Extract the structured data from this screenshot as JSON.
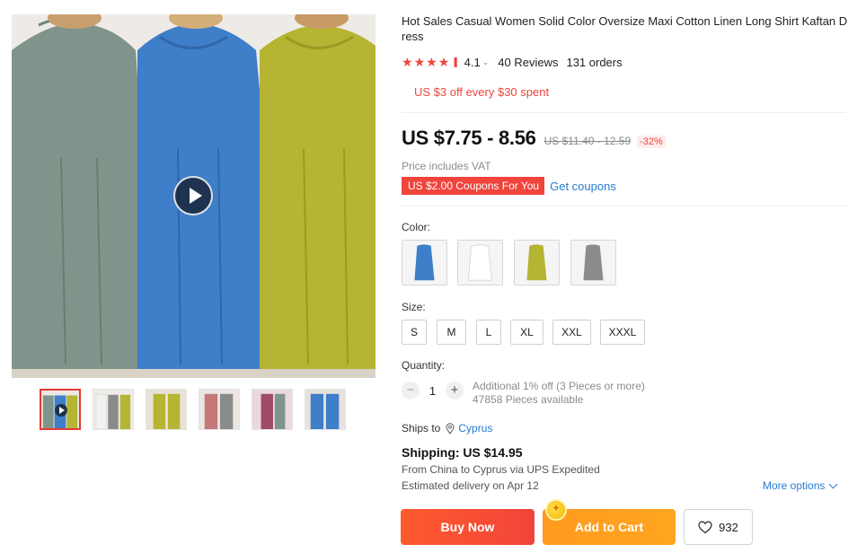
{
  "product": {
    "title": "Hot Sales Casual Women Solid Color Oversize Maxi Cotton Linen Long Shirt Kaftan Dress",
    "rating": "4.1",
    "reviews": "40 Reviews",
    "orders": "131 orders",
    "promo": "US $3 off every $30 spent"
  },
  "price": {
    "current": "US $7.75 - 8.56",
    "original": "US $11.40 - 12.59",
    "discount": "-32%",
    "vat_note": "Price includes VAT",
    "coupon_badge": "US $2.00 Coupons For You",
    "get_coupons": "Get coupons"
  },
  "options": {
    "color_label": "Color:",
    "colors": [
      "#3f7ec8",
      "#f4f2f0",
      "#b5b433",
      "#8a8c8c"
    ],
    "size_label": "Size:",
    "sizes": [
      "S",
      "M",
      "L",
      "XL",
      "XXL",
      "XXXL"
    ],
    "quantity_label": "Quantity:",
    "quantity": "1",
    "quantity_note_1": "Additional 1% off (3 Pieces or more)",
    "quantity_note_2": "47858 Pieces available"
  },
  "shipping": {
    "ships_to_label": "Ships to",
    "ships_to_country": "Cyprus",
    "cost": "Shipping: US $14.95",
    "route": "From China to Cyprus via UPS Expedited",
    "delivery": "Estimated delivery on Apr 12",
    "more_options": "More options"
  },
  "actions": {
    "buy_now": "Buy Now",
    "add_to_cart": "Add to Cart",
    "wishlist_count": "932"
  },
  "gallery": {
    "dress_colors": [
      "#7f948a",
      "#3f7ec8",
      "#b5b433"
    ],
    "thumbnail_count": 6
  },
  "colors": {
    "accent_red": "#f0443c",
    "accent_orange": "#ffa51f",
    "link_blue": "#2a7bd2"
  }
}
